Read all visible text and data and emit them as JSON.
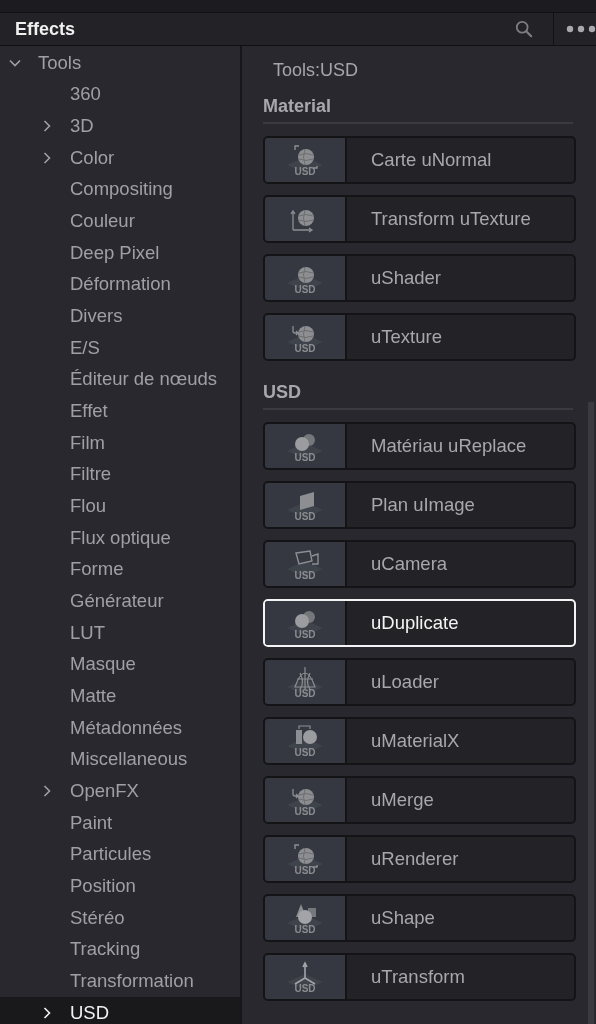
{
  "panel": {
    "title": "Effects"
  },
  "sidebar": {
    "items": [
      {
        "label": "Tools",
        "expanded": true,
        "selected": false,
        "children": [
          {
            "label": "360",
            "selected": false
          },
          {
            "label": "3D",
            "expanded": false,
            "selected": false
          },
          {
            "label": "Color",
            "expanded": false,
            "selected": false
          },
          {
            "label": "Compositing",
            "selected": false
          },
          {
            "label": "Couleur",
            "selected": false
          },
          {
            "label": "Deep Pixel",
            "selected": false
          },
          {
            "label": "Déformation",
            "selected": false
          },
          {
            "label": "Divers",
            "selected": false
          },
          {
            "label": "E/S",
            "selected": false
          },
          {
            "label": "Éditeur de nœuds",
            "selected": false
          },
          {
            "label": "Effet",
            "selected": false
          },
          {
            "label": "Film",
            "selected": false
          },
          {
            "label": "Filtre",
            "selected": false
          },
          {
            "label": "Flou",
            "selected": false
          },
          {
            "label": "Flux optique",
            "selected": false
          },
          {
            "label": "Forme",
            "selected": false
          },
          {
            "label": "Générateur",
            "selected": false
          },
          {
            "label": "LUT",
            "selected": false
          },
          {
            "label": "Masque",
            "selected": false
          },
          {
            "label": "Matte",
            "selected": false
          },
          {
            "label": "Métadonnées",
            "selected": false
          },
          {
            "label": "Miscellaneous",
            "selected": false
          },
          {
            "label": "OpenFX",
            "expanded": false,
            "selected": false
          },
          {
            "label": "Paint",
            "selected": false
          },
          {
            "label": "Particules",
            "selected": false
          },
          {
            "label": "Position",
            "selected": false
          },
          {
            "label": "Stéréo",
            "selected": false
          },
          {
            "label": "Tracking",
            "selected": false
          },
          {
            "label": "Transformation",
            "selected": false
          },
          {
            "label": "USD",
            "expanded": false,
            "selected": true
          }
        ]
      }
    ]
  },
  "content": {
    "path": "Tools:USD",
    "sections": [
      {
        "title": "Material",
        "tools": [
          {
            "label": "Carte uNormal",
            "kind": "framed-sphere",
            "badge": "USD",
            "selected": false
          },
          {
            "label": "Transform uTexture",
            "kind": "axes-sphere",
            "selected": false
          },
          {
            "label": "uShader",
            "kind": "sphere",
            "badge": "USD",
            "selected": false
          },
          {
            "label": "uTexture",
            "kind": "arrow-sphere",
            "badge": "USD",
            "selected": false
          }
        ]
      },
      {
        "title": "USD",
        "tools": [
          {
            "label": "Matériau uReplace",
            "kind": "spheres",
            "badge": "USD",
            "selected": false
          },
          {
            "label": "Plan uImage",
            "kind": "plane",
            "badge": "USD",
            "selected": false
          },
          {
            "label": "uCamera",
            "kind": "camera",
            "badge": "USD",
            "selected": false
          },
          {
            "label": "uDuplicate",
            "kind": "spheres",
            "badge": "USD",
            "selected": true
          },
          {
            "label": "uLoader",
            "kind": "mesh",
            "badge": "USD",
            "selected": false
          },
          {
            "label": "uMaterialX",
            "kind": "book-sphere",
            "badge": "USD",
            "selected": false
          },
          {
            "label": "uMerge",
            "kind": "arrow-sphere",
            "badge": "USD",
            "selected": false
          },
          {
            "label": "uRenderer",
            "kind": "framed-sphere",
            "badge": "USD",
            "selected": false
          },
          {
            "label": "uShape",
            "kind": "shapes",
            "badge": "USD",
            "selected": false
          },
          {
            "label": "uTransform",
            "kind": "axes",
            "badge": "USD",
            "selected": false
          }
        ]
      }
    ]
  }
}
